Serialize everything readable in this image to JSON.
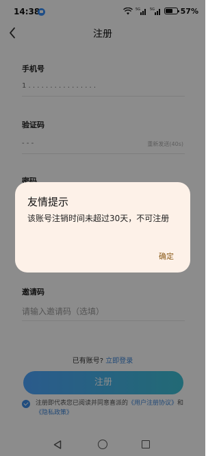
{
  "status_bar": {
    "time": "14:38",
    "battery": "57%",
    "network_label": "5G"
  },
  "header": {
    "title": "注册"
  },
  "form": {
    "phone_label": "手机号",
    "phone_value": "1 . . . . . . . . . . . . . . . .",
    "code_label": "验证码",
    "code_value": "- - -",
    "code_hint": "重新发送(40s)",
    "password_label": "密码",
    "invite_label": "邀请码",
    "invite_placeholder": "请输入邀请码（选填）"
  },
  "login_row": {
    "question": "已有账号?",
    "link": "立即登录"
  },
  "register_button": "注册",
  "agreement": {
    "checked": true,
    "prefix": "注册即代表您已阅读并同意喜派的",
    "link1": "《用户注册协议》",
    "middle": "和",
    "link2": "《隐私政策》"
  },
  "dialog": {
    "title": "友情提示",
    "message": "该账号注销时间未超过30天，不可注册",
    "confirm": "确定"
  },
  "colors": {
    "accent": "#3e86d8",
    "button_start": "#4ea6ff",
    "button_end": "#3fc1d6",
    "dialog_bg": "#fdf1e8",
    "dialog_confirm": "#8a5a18"
  }
}
